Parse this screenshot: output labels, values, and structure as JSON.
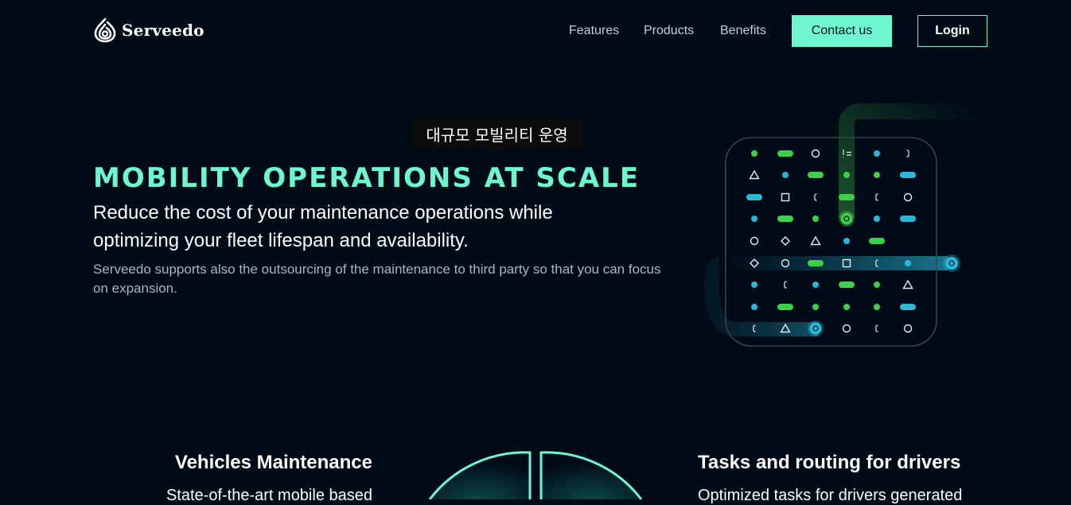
{
  "brand": {
    "name": "Serveedo"
  },
  "nav": {
    "links": [
      "Features",
      "Products",
      "Benefits"
    ],
    "contact_label": "Contact us",
    "login_label": "Login"
  },
  "hero": {
    "tooltip": "대규모 모빌리티 운영",
    "title": "MOBILITY OPERATIONS AT SCALE",
    "subtitle": "Reduce the cost of your maintenance operations while optimizing your fleet lifespan and availability.",
    "description": "Serveedo supports also the outsourcing of the maintenance to third party so that you can focus on expansion."
  },
  "features": {
    "left": {
      "title": "Vehicles Maintenance",
      "desc": "State-of-the-art mobile based"
    },
    "right": {
      "title": "Tasks and routing for drivers",
      "desc": "Optimized tasks for drivers generated"
    }
  },
  "colors": {
    "background": "#000b18",
    "accent": "#6ff6cf",
    "green": "#3ecf4c",
    "blue": "#2bb8d8"
  },
  "icons": [
    "serveedo-logo-icon",
    "route-node-icon"
  ]
}
